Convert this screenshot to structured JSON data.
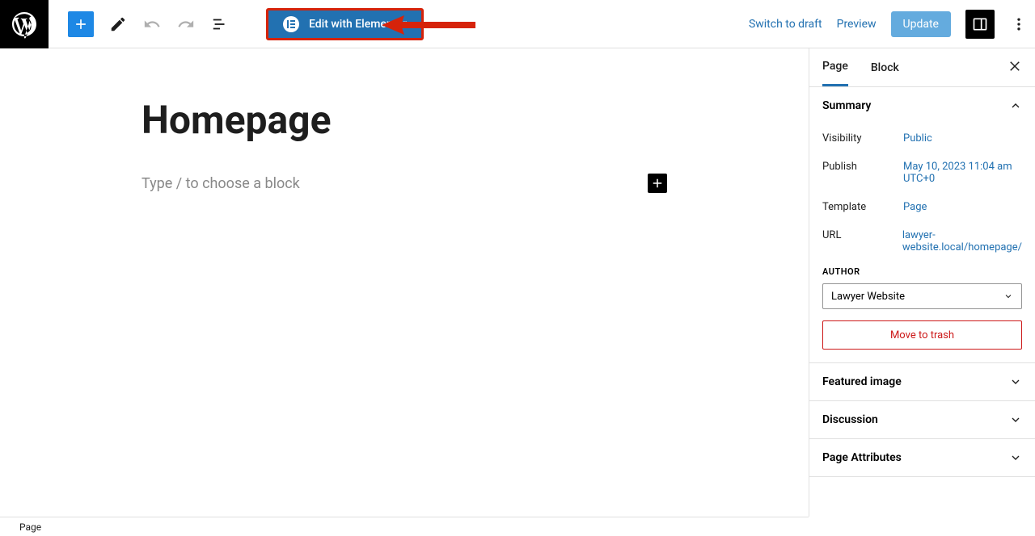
{
  "toolbar": {
    "elementor_label": "Edit with Elementor",
    "switch_draft": "Switch to draft",
    "preview": "Preview",
    "update": "Update"
  },
  "editor": {
    "title": "Homepage",
    "placeholder": "Type / to choose a block"
  },
  "sidebar": {
    "tab_page": "Page",
    "tab_block": "Block",
    "summary": {
      "title": "Summary",
      "visibility_label": "Visibility",
      "visibility_value": "Public",
      "publish_label": "Publish",
      "publish_value": "May 10, 2023 11:04 am UTC+0",
      "template_label": "Template",
      "template_value": "Page",
      "url_label": "URL",
      "url_value": "lawyer-website.local/homepage/",
      "author_label": "AUTHOR",
      "author_value": "Lawyer Website",
      "trash": "Move to trash"
    },
    "featured_image": "Featured image",
    "discussion": "Discussion",
    "page_attributes": "Page Attributes"
  },
  "breadcrumb": "Page"
}
